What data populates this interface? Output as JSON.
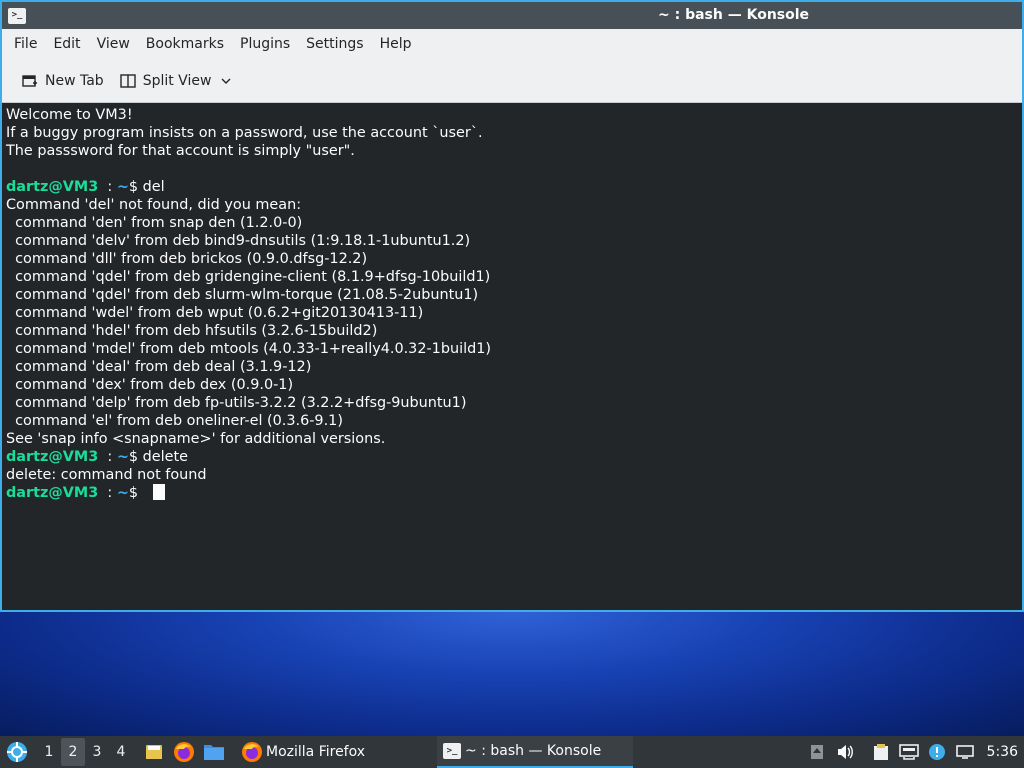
{
  "window": {
    "title": "~ : bash — Konsole",
    "app_icon": "terminal-icon"
  },
  "menubar": {
    "items": [
      "File",
      "Edit",
      "View",
      "Bookmarks",
      "Plugins",
      "Settings",
      "Help"
    ]
  },
  "toolbar": {
    "new_tab_label": "New Tab",
    "split_view_label": "Split View"
  },
  "terminal": {
    "prompt_user": "dartz@VM3",
    "prompt_sep": "  : ",
    "prompt_path": "~",
    "prompt_end": "$ ",
    "lines": [
      {
        "type": "text",
        "text": "Welcome to VM3!"
      },
      {
        "type": "text",
        "text": "If a buggy program insists on a password, use the account `user`."
      },
      {
        "type": "text",
        "text": "The passsword for that account is simply \"user\"."
      },
      {
        "type": "text",
        "text": ""
      },
      {
        "type": "prompt",
        "cmd": "del"
      },
      {
        "type": "text",
        "text": "Command 'del' not found, did you mean:"
      },
      {
        "type": "text",
        "text": "  command 'den' from snap den (1.2.0-0)"
      },
      {
        "type": "text",
        "text": "  command 'delv' from deb bind9-dnsutils (1:9.18.1-1ubuntu1.2)"
      },
      {
        "type": "text",
        "text": "  command 'dll' from deb brickos (0.9.0.dfsg-12.2)"
      },
      {
        "type": "text",
        "text": "  command 'qdel' from deb gridengine-client (8.1.9+dfsg-10build1)"
      },
      {
        "type": "text",
        "text": "  command 'qdel' from deb slurm-wlm-torque (21.08.5-2ubuntu1)"
      },
      {
        "type": "text",
        "text": "  command 'wdel' from deb wput (0.6.2+git20130413-11)"
      },
      {
        "type": "text",
        "text": "  command 'hdel' from deb hfsutils (3.2.6-15build2)"
      },
      {
        "type": "text",
        "text": "  command 'mdel' from deb mtools (4.0.33-1+really4.0.32-1build1)"
      },
      {
        "type": "text",
        "text": "  command 'deal' from deb deal (3.1.9-12)"
      },
      {
        "type": "text",
        "text": "  command 'dex' from deb dex (0.9.0-1)"
      },
      {
        "type": "text",
        "text": "  command 'delp' from deb fp-utils-3.2.2 (3.2.2+dfsg-9ubuntu1)"
      },
      {
        "type": "text",
        "text": "  command 'el' from deb oneliner-el (0.3.6-9.1)"
      },
      {
        "type": "text",
        "text": "See 'snap info <snapname>' for additional versions."
      },
      {
        "type": "prompt",
        "cmd": "delete"
      },
      {
        "type": "text",
        "text": "delete: command not found"
      },
      {
        "type": "prompt",
        "cmd": "",
        "cursor": true
      }
    ]
  },
  "taskbar": {
    "desktops": [
      "1",
      "2",
      "3",
      "4"
    ],
    "active_desktop": "2",
    "tasks": [
      {
        "label": "Mozilla Firefox",
        "icon": "firefox-icon"
      },
      {
        "label": "~ : bash — Konsole",
        "icon": "terminal-icon",
        "active": true
      }
    ],
    "clock": "5:36"
  }
}
